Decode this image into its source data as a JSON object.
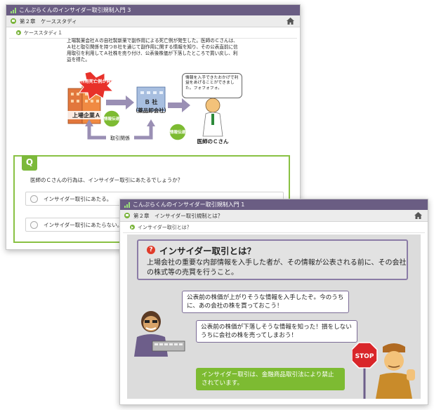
{
  "window1": {
    "title": "こんぷらくんのインサイダー取引規制入門 3",
    "chapter": "第２章　ケーススタディ",
    "section": "ケーススタディ１",
    "case_text": "上場製薬会社Ａの自社製新薬で副作用による死亡例が発生した。医師のＣさんは、Ａ社と取引関係を持つＢ社を通じて副作用に関する情報を知り、その公表直前に信用取引を利用してＡ社株を売り付け、公表後株価が下落したところで買い戻し、利益を得た。",
    "illustration": {
      "burst_text": "副作用死亡例が発生",
      "company_a": "上場企業Ａ",
      "company_b_line1": "Ｂ 社",
      "company_b_line2": "（薬品卸会社）",
      "info_badge_1": "情報伝達",
      "info_badge_2": "情報伝達",
      "relation": "取引関係",
      "thought": "情報を入手できたおかげで利益をあげることができました。フォフォフォ。",
      "doctor_label": "医師のＣさん"
    },
    "question_badge": "Q",
    "question": "医師のＣさんの行為は、インサイダー取引にあたるでしょうか？",
    "options": [
      "インサイダー取引にあたる。",
      "インサイダー取引にあたらない。"
    ]
  },
  "window2": {
    "title": "こんぷらくんのインサイダー取引規制入門 1",
    "chapter": "第２章　インサイダー取引規制とは？",
    "section": "インサイダー取引とは？",
    "heading": "インサイダー取引とは？",
    "heading_mark": "?",
    "description": "上場会社の重要な内部情報を入手した者が、その情報が公表される前に、その会社の株式等の売買を行うこと。",
    "bubble1": "公表前の株価が上がりそうな情報を入手したぞ。今のうちに、あの会社の株を買っておこう！",
    "bubble2": "公表前の株価が下落しそうな情報を知った！損をしないうちに会社の株を売ってしまおう！",
    "warning": "インサイダー取引は、金融商品取引法により禁止されています。",
    "stop_sign": "STOP"
  },
  "colors": {
    "titlebar": "#6a5d83",
    "accent_green": "#7dbb32",
    "purple_border": "#8b7ca6",
    "stop_red": "#d9262a"
  }
}
